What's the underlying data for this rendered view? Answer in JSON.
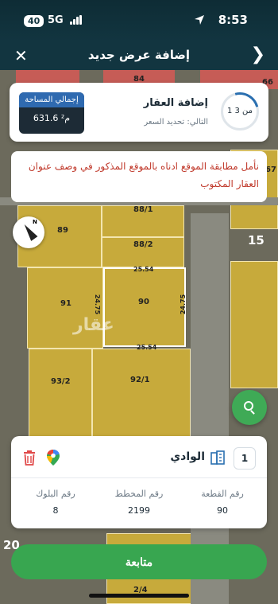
{
  "status": {
    "battery": "40",
    "network": "5G",
    "time": "8:53"
  },
  "header": {
    "title": "إضافة عرض جديد",
    "close": "✕",
    "back": "❯"
  },
  "property_card": {
    "step": "1 من 3",
    "title": "إضافة العقار",
    "next_step": "التالي: تحديد السعر",
    "area_label": "إجمالي المساحة",
    "area_value": "631.6 م²"
  },
  "warning": "نأمل مطابقة الموقع ادناه بالموقع المذكور في وصف عنوان العقار المكتوب",
  "map": {
    "labels": {
      "p88_1": "88/1",
      "p88_2": "88/2",
      "p89": "89",
      "p91": "91",
      "p90": "90",
      "p93_2": "93/2",
      "p92_1": "92/1",
      "p84": "84",
      "p66": "66",
      "p67": "67",
      "p15": "15",
      "p20": "20",
      "p2_4": "2/4",
      "dim_top": "25.54",
      "dim_bottom": "25.54",
      "dim_left": "24.75",
      "dim_right": "24.75"
    },
    "watermark": "عقار"
  },
  "bottom_card": {
    "index": "1",
    "district": "الوادي",
    "fields": [
      {
        "label": "رقم القطعة",
        "value": "90"
      },
      {
        "label": "رقم المخطط",
        "value": "2199"
      },
      {
        "label": "رقم البلوك",
        "value": "8"
      }
    ]
  },
  "continue_label": "متابعة"
}
